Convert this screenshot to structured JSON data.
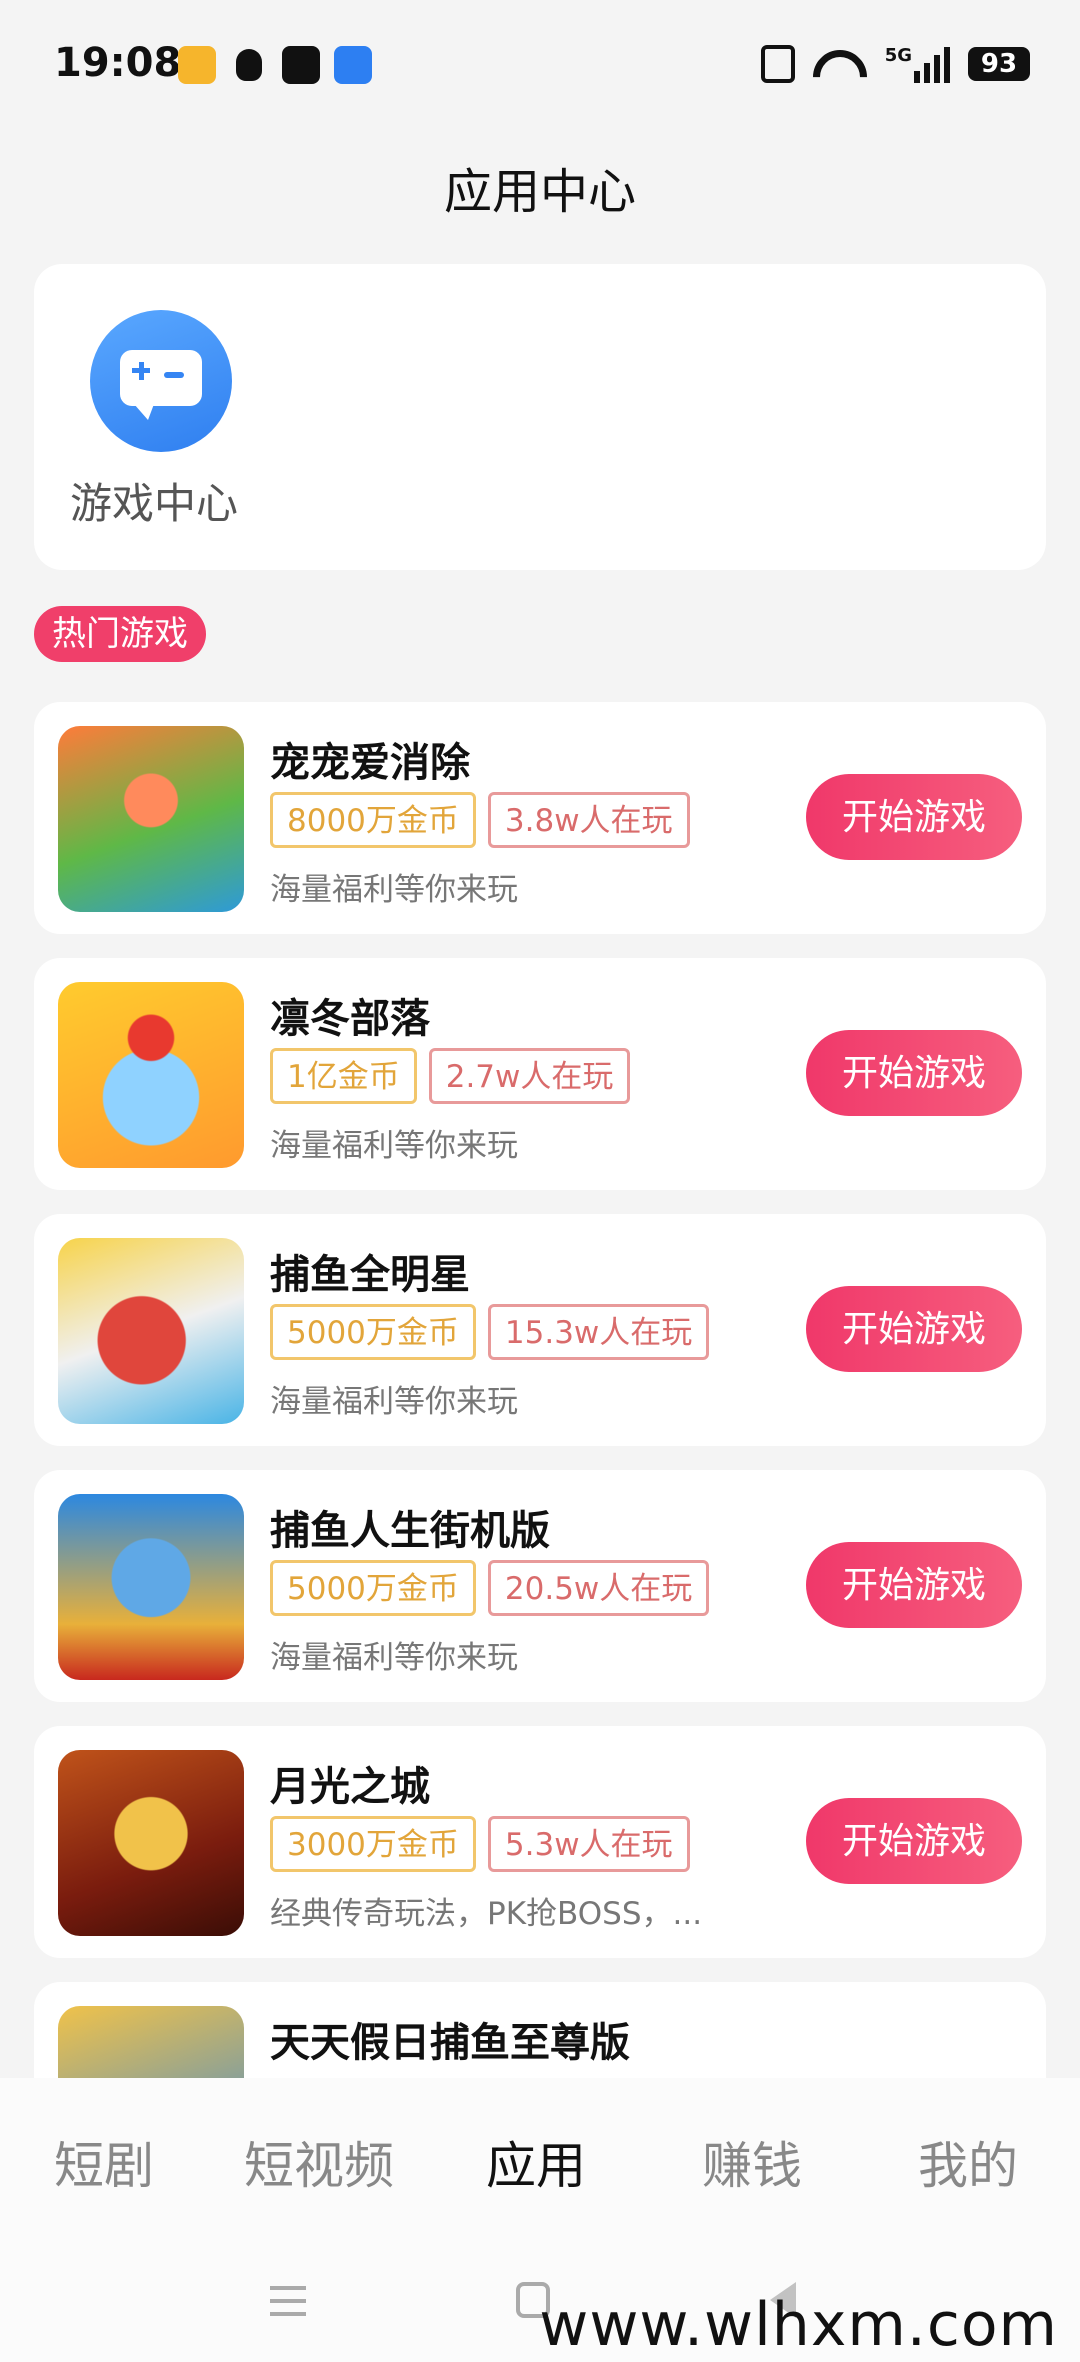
{
  "status_bar": {
    "time": "19:08",
    "notification_icons": [
      "weibo-icon",
      "qq-icon",
      "tiktok-icon",
      "blue-app-icon"
    ],
    "network_label": "5G",
    "battery": "93"
  },
  "page_title": "应用中心",
  "game_center": {
    "label": "游戏中心"
  },
  "hot_section": {
    "label": "热门游戏"
  },
  "games": [
    {
      "name": "宠宠爱消除",
      "coin": "8000万金币",
      "players": "3.8w人在玩",
      "desc": "海量福利等你来玩",
      "button": "开始游戏"
    },
    {
      "name": "凛冬部落",
      "coin": "1亿金币",
      "players": "2.7w人在玩",
      "desc": "海量福利等你来玩",
      "button": "开始游戏"
    },
    {
      "name": "捕鱼全明星",
      "coin": "5000万金币",
      "players": "15.3w人在玩",
      "desc": "海量福利等你来玩",
      "button": "开始游戏"
    },
    {
      "name": "捕鱼人生街机版",
      "coin": "5000万金币",
      "players": "20.5w人在玩",
      "desc": "海量福利等你来玩",
      "button": "开始游戏"
    },
    {
      "name": "月光之城",
      "coin": "3000万金币",
      "players": "5.3w人在玩",
      "desc": "经典传奇玩法，PK抢BOSS，...",
      "button": "开始游戏"
    },
    {
      "name": "天天假日捕鱼至尊版",
      "coin": "",
      "players": "",
      "desc": "",
      "button": ""
    }
  ],
  "bottom_nav": {
    "items": [
      "短剧",
      "短视频",
      "应用",
      "赚钱",
      "我的"
    ],
    "active": "应用"
  },
  "watermark": "www.wlhxm.com"
}
